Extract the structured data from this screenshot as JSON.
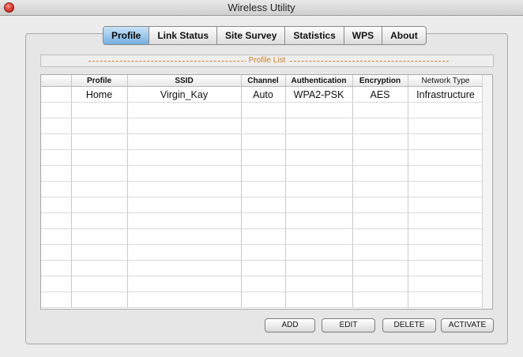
{
  "window": {
    "title": "Wireless Utility"
  },
  "tabs": [
    {
      "label": "Profile",
      "active": true
    },
    {
      "label": "Link Status",
      "active": false
    },
    {
      "label": "Site Survey",
      "active": false
    },
    {
      "label": "Statistics",
      "active": false
    },
    {
      "label": "WPS",
      "active": false
    },
    {
      "label": "About",
      "active": false
    }
  ],
  "profile_list": {
    "title": "Profile List",
    "columns": [
      "Profile",
      "SSID",
      "Channel",
      "Authentication",
      "Encryption",
      "Network Type"
    ],
    "rows": [
      {
        "profile": "Home",
        "ssid": "Virgin_Kay",
        "channel": "Auto",
        "authentication": "WPA2-PSK",
        "encryption": "AES",
        "network_type": "Infrastructure"
      }
    ]
  },
  "buttons": {
    "add": "ADD",
    "edit": "EDIT",
    "delete": "DELETE",
    "activate": "ACTIVATE"
  },
  "colors": {
    "active_tab": "#74aee0",
    "section_label": "#c9822e",
    "close_button": "#e0443a"
  }
}
